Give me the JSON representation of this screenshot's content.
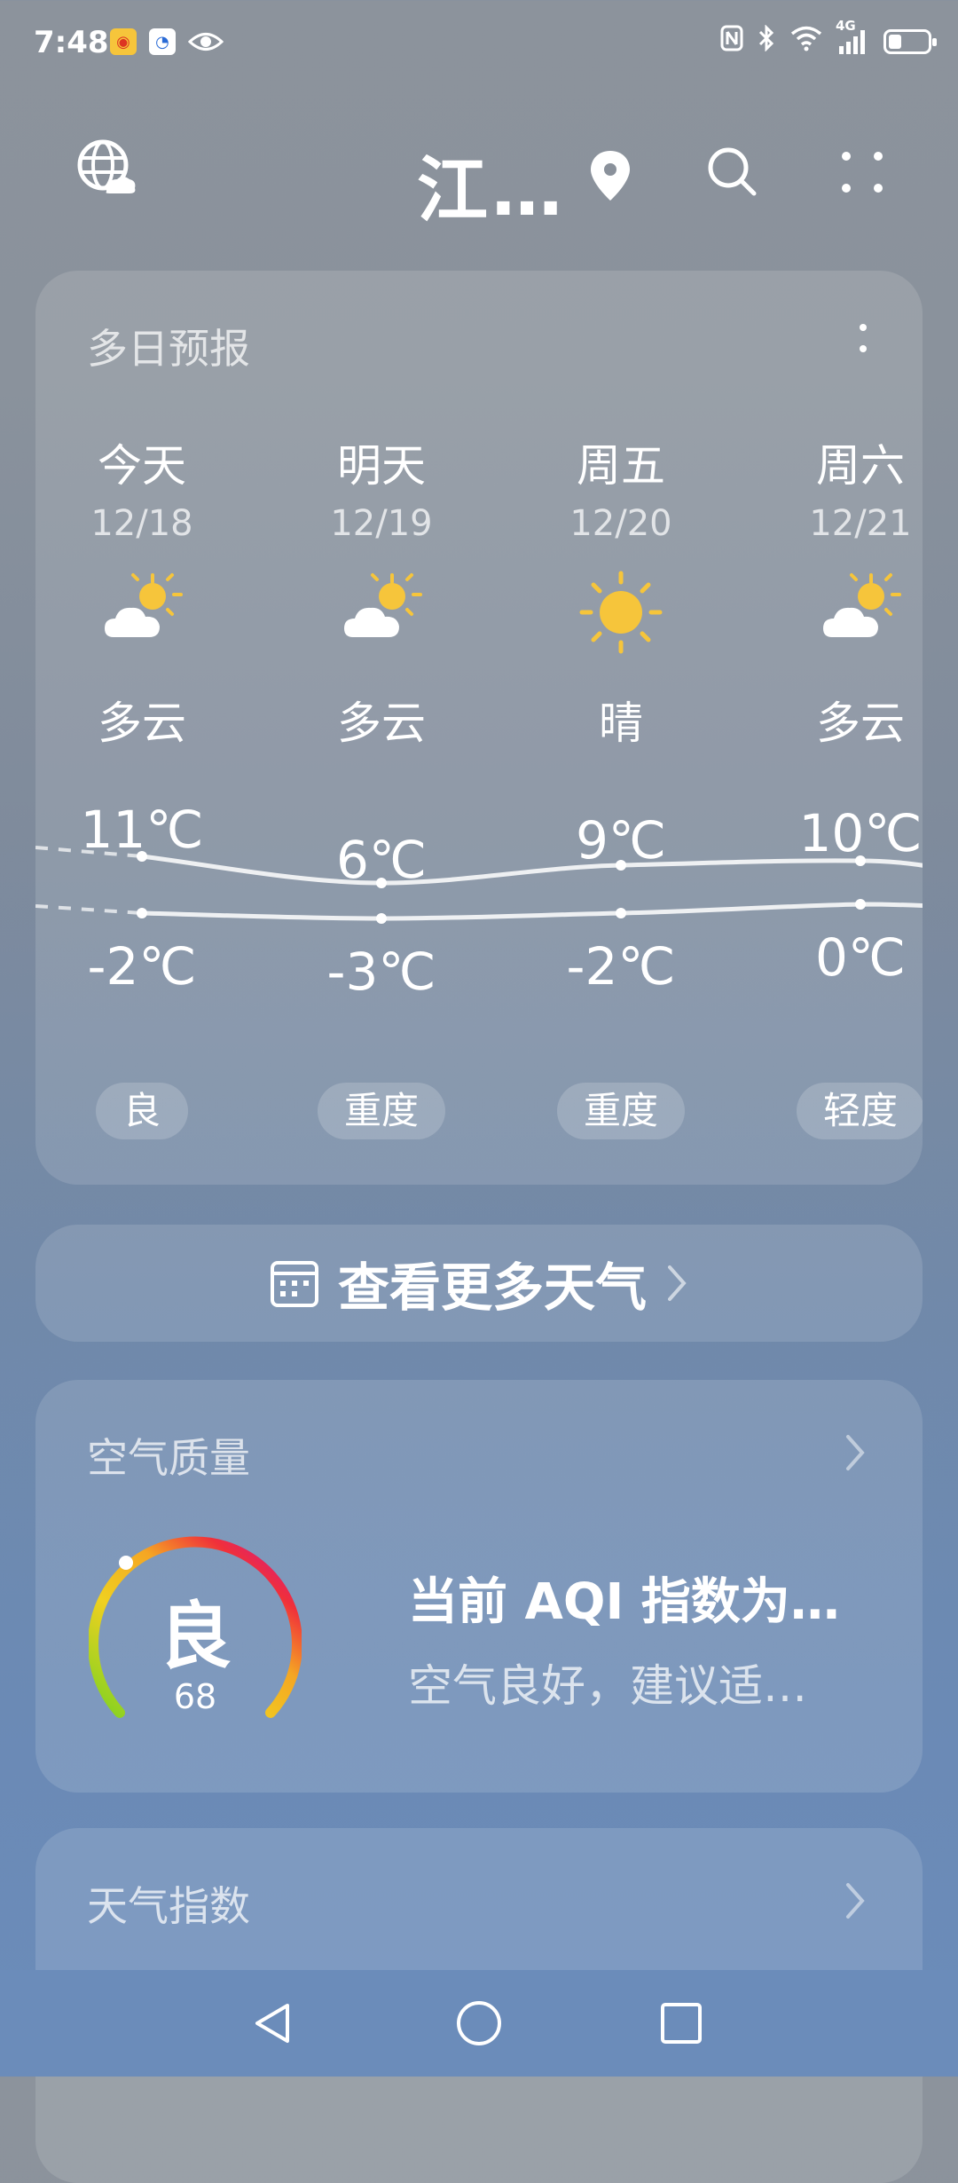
{
  "status_bar": {
    "time": "7:48",
    "network": "4G"
  },
  "header": {
    "city": "江…"
  },
  "forecast": {
    "title": "多日预报",
    "days": [
      {
        "name": "今天",
        "date": "12/18",
        "icon": "partly-cloudy-icon",
        "condition": "多云",
        "high": "11℃",
        "low": "-2℃",
        "aqi": "良"
      },
      {
        "name": "明天",
        "date": "12/19",
        "icon": "partly-cloudy-icon",
        "condition": "多云",
        "high": "6℃",
        "low": "-3℃",
        "aqi": "重度"
      },
      {
        "name": "周五",
        "date": "12/20",
        "icon": "sunny-icon",
        "condition": "晴",
        "high": "9℃",
        "low": "-2℃",
        "aqi": "重度"
      },
      {
        "name": "周六",
        "date": "12/21",
        "icon": "partly-cloudy-icon",
        "condition": "多云",
        "high": "10℃",
        "low": "0℃",
        "aqi": "轻度"
      }
    ]
  },
  "more_weather": {
    "label": "查看更多天气"
  },
  "air_quality": {
    "title": "空气质量",
    "level": "良",
    "value": "68",
    "headline": "当前 AQI 指数为…",
    "advice": "空气良好，建议适…"
  },
  "weather_index": {
    "title": "天气指数"
  },
  "colors": {
    "sun": "#F6C53B",
    "gauge_start": "#7ED321",
    "gauge_mid": "#F5A623",
    "gauge_end": "#D0109E"
  }
}
